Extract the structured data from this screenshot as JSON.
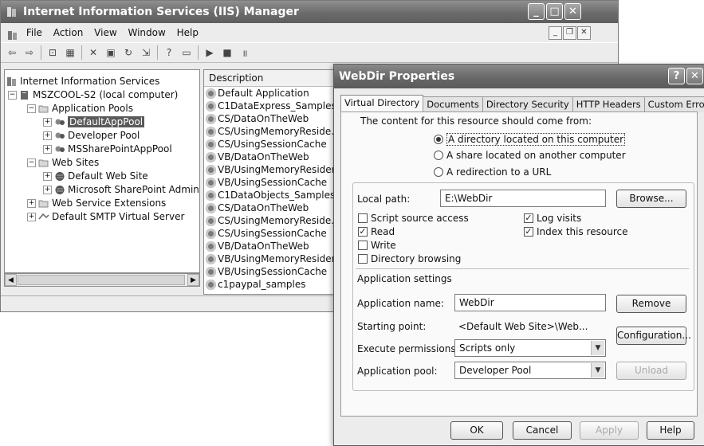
{
  "iis": {
    "title": "Internet Information Services (IIS) Manager",
    "menu": [
      "File",
      "Action",
      "View",
      "Window",
      "Help"
    ],
    "tree": {
      "root": "Internet Information Services",
      "server": "MSZCOOL-S2 (local computer)",
      "app_pools": "Application Pools",
      "pool1": "DefaultAppPool",
      "pool2": "Developer Pool",
      "pool3": "MSSharePointAppPool",
      "web_sites": "Web Sites",
      "site1": "Default Web Site",
      "site2": "Microsoft SharePoint Administr",
      "ext": "Web Service Extensions",
      "smtp": "Default SMTP Virtual Server"
    },
    "list_header": "Description",
    "list_items": [
      "Default Application",
      "C1DataExpress_Samples",
      "CS/DataOnTheWeb",
      "CS/UsingMemoryReside...",
      "CS/UsingSessionCache",
      "VB/DataOnTheWeb",
      "VB/UsingMemoryResident",
      "VB/UsingSessionCache",
      "C1DataObjects_Samples",
      "CS/DataOnTheWeb",
      "CS/UsingMemoryReside...",
      "CS/UsingSessionCache",
      "VB/DataOnTheWeb",
      "VB/UsingMemoryResident",
      "VB/UsingSessionCache",
      "c1paypal_samples"
    ]
  },
  "dialog": {
    "title": "WebDir Properties",
    "tabs": [
      "Virtual Directory",
      "Documents",
      "Directory Security",
      "HTTP Headers",
      "Custom Errors"
    ],
    "content_from": "The content for this resource should come from:",
    "radio1": "A directory located on this computer",
    "radio2": "A share located on another computer",
    "radio3": "A redirection to a URL",
    "local_path_label": "Local path:",
    "local_path_value": "E:\\WebDir",
    "browse": "Browse...",
    "cb_script": "Script source access",
    "cb_read": "Read",
    "cb_write": "Write",
    "cb_dirbrowse": "Directory browsing",
    "cb_log": "Log visits",
    "cb_index": "Index this resource",
    "app_settings": "Application settings",
    "app_name_label": "Application name:",
    "app_name_value": "WebDir",
    "remove": "Remove",
    "starting_label": "Starting point:",
    "starting_value": "<Default Web Site>\\Web...",
    "configuration": "Configuration...",
    "exec_label": "Execute permissions:",
    "exec_value": "Scripts only",
    "pool_label": "Application pool:",
    "pool_value": "Developer Pool",
    "unload": "Unload",
    "ok": "OK",
    "cancel": "Cancel",
    "apply": "Apply",
    "help": "Help"
  }
}
